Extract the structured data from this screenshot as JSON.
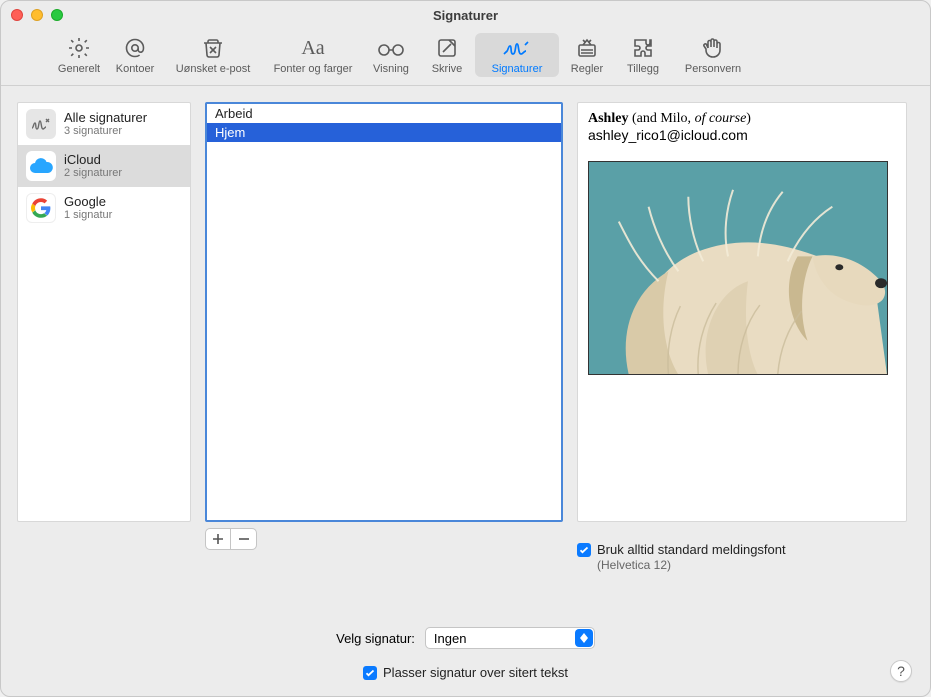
{
  "window": {
    "title": "Signaturer"
  },
  "toolbar": {
    "items": [
      {
        "label": "Generelt",
        "icon": "gear"
      },
      {
        "label": "Kontoer",
        "icon": "at"
      },
      {
        "label": "Uønsket e-post",
        "icon": "trash-x"
      },
      {
        "label": "Fonter og farger",
        "icon": "Aa"
      },
      {
        "label": "Visning",
        "icon": "glasses"
      },
      {
        "label": "Skrive",
        "icon": "compose"
      },
      {
        "label": "Signaturer",
        "icon": "signature",
        "selected": true
      },
      {
        "label": "Regler",
        "icon": "rules"
      },
      {
        "label": "Tillegg",
        "icon": "puzzle"
      },
      {
        "label": "Personvern",
        "icon": "hand"
      }
    ]
  },
  "accounts": [
    {
      "name": "Alle signaturer",
      "sub": "3 signaturer",
      "icon": "all"
    },
    {
      "name": "iCloud",
      "sub": "2 signaturer",
      "icon": "icloud",
      "selected": true
    },
    {
      "name": "Google",
      "sub": "1 signatur",
      "icon": "google"
    }
  ],
  "signatures": [
    {
      "name": "Arbeid"
    },
    {
      "name": "Hjem",
      "selected": true
    }
  ],
  "buttons": {
    "add": "+",
    "remove": "−"
  },
  "preview": {
    "name_bold": "Ashley",
    "name_paren_open": " (and Milo, ",
    "name_italic": "of course",
    "name_paren_close": ")",
    "email": "ashley_rico1@icloud.com",
    "image_alt": "dog-photo"
  },
  "options": {
    "usedefault_label": "Bruk alltid standard meldingsfont",
    "usedefault_sub": "(Helvetica 12)",
    "choose_label": "Velg signatur:",
    "choose_value": "Ingen",
    "place_label": "Plasser signatur over sitert tekst"
  },
  "help": "?"
}
